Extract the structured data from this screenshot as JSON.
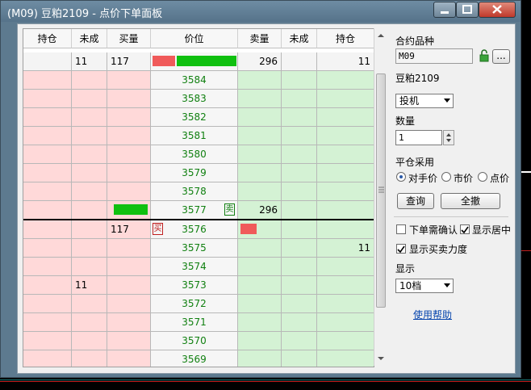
{
  "window": {
    "title": "(M09) 豆粕2109 - 点价下单面板"
  },
  "grid": {
    "headers": [
      "持仓",
      "未成",
      "买量",
      "价位",
      "卖量",
      "未成",
      "持仓"
    ],
    "summary": {
      "hold_buy": "",
      "pending_buy": "11",
      "buy_qty": "117",
      "sell_qty": "296",
      "pending_sell": "",
      "hold_sell": "11"
    },
    "rows": [
      {
        "price": "3584",
        "hold_buy": "",
        "pending_buy": "",
        "buy_qty": "",
        "sell_qty": "",
        "pending_sell": "",
        "hold_sell": ""
      },
      {
        "price": "3583",
        "hold_buy": "",
        "pending_buy": "",
        "buy_qty": "",
        "sell_qty": "",
        "pending_sell": "",
        "hold_sell": ""
      },
      {
        "price": "3582",
        "hold_buy": "",
        "pending_buy": "",
        "buy_qty": "",
        "sell_qty": "",
        "pending_sell": "",
        "hold_sell": ""
      },
      {
        "price": "3581",
        "hold_buy": "",
        "pending_buy": "",
        "buy_qty": "",
        "sell_qty": "",
        "pending_sell": "",
        "hold_sell": ""
      },
      {
        "price": "3580",
        "hold_buy": "",
        "pending_buy": "",
        "buy_qty": "",
        "sell_qty": "",
        "pending_sell": "",
        "hold_sell": ""
      },
      {
        "price": "3579",
        "hold_buy": "",
        "pending_buy": "",
        "buy_qty": "",
        "sell_qty": "",
        "pending_sell": "",
        "hold_sell": ""
      },
      {
        "price": "3578",
        "hold_buy": "",
        "pending_buy": "",
        "buy_qty": "",
        "sell_qty": "",
        "pending_sell": "",
        "hold_sell": ""
      },
      {
        "price": "3577",
        "hold_buy": "",
        "pending_buy": "",
        "buy_qty": "",
        "sell_qty": "296",
        "pending_sell": "",
        "hold_sell": "",
        "tag": "卖"
      },
      {
        "price": "3576",
        "hold_buy": "",
        "pending_buy": "",
        "buy_qty": "117",
        "sell_qty": "",
        "pending_sell": "",
        "hold_sell": "",
        "tag": "买"
      },
      {
        "price": "3575",
        "hold_buy": "",
        "pending_buy": "",
        "buy_qty": "",
        "sell_qty": "",
        "pending_sell": "",
        "hold_sell": "11"
      },
      {
        "price": "3574",
        "hold_buy": "",
        "pending_buy": "",
        "buy_qty": "",
        "sell_qty": "",
        "pending_sell": "",
        "hold_sell": ""
      },
      {
        "price": "3573",
        "hold_buy": "",
        "pending_buy": "11",
        "buy_qty": "",
        "sell_qty": "",
        "pending_sell": "",
        "hold_sell": ""
      },
      {
        "price": "3572",
        "hold_buy": "",
        "pending_buy": "",
        "buy_qty": "",
        "sell_qty": "",
        "pending_sell": "",
        "hold_sell": ""
      },
      {
        "price": "3571",
        "hold_buy": "",
        "pending_buy": "",
        "buy_qty": "",
        "sell_qty": "",
        "pending_sell": "",
        "hold_sell": ""
      },
      {
        "price": "3570",
        "hold_buy": "",
        "pending_buy": "",
        "buy_qty": "",
        "sell_qty": "",
        "pending_sell": "",
        "hold_sell": ""
      },
      {
        "price": "3569",
        "hold_buy": "",
        "pending_buy": "",
        "buy_qty": "",
        "sell_qty": "",
        "pending_sell": "",
        "hold_sell": ""
      }
    ]
  },
  "panel": {
    "contract_label": "合约品种",
    "contract_value": "M09",
    "browse_label": "...",
    "contract_name": "豆粕2109",
    "type_value": "投机",
    "qty_label": "数量",
    "qty_value": "1",
    "close_label": "平仓采用",
    "close_options": [
      "对手价",
      "市价",
      "点价"
    ],
    "close_selected": "对手价",
    "query_btn": "查询",
    "cancel_all_btn": "全撤",
    "chk_confirm": "下单需确认",
    "chk_center": "显示居中",
    "chk_force": "显示买卖力度",
    "display_label": "显示",
    "display_value": "10档",
    "help_link": "使用帮助"
  },
  "colors": {
    "buy": "#ffd9d9",
    "sell": "#d4f2d4",
    "price_text": "#118011",
    "bar_red": "#f05a5a",
    "bar_green": "#10c010"
  }
}
